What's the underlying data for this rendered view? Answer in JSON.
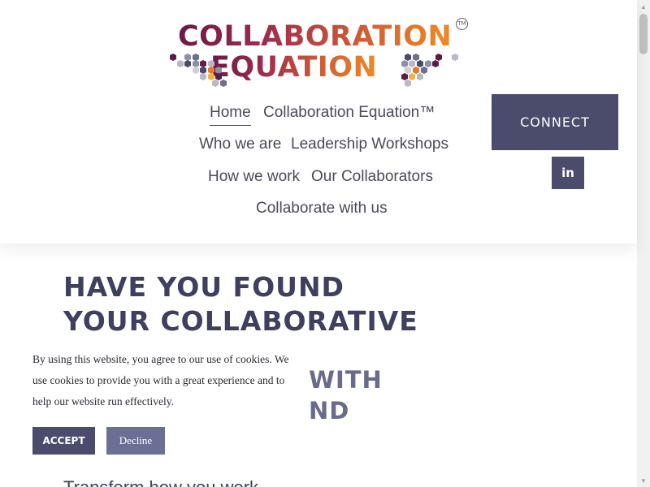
{
  "logo": {
    "line1": "COLLABORATION",
    "line2": "EQUATION",
    "tm": "TM",
    "colors": [
      "#6a1a44",
      "#9b2a4e",
      "#cf5a35",
      "#ee8a28"
    ]
  },
  "nav": {
    "items": [
      {
        "label": "Home",
        "active": true
      },
      {
        "label": "Collaboration Equation™"
      },
      {
        "label": "Who we are"
      },
      {
        "label": "Leadership Workshops"
      },
      {
        "label": "How we work"
      },
      {
        "label": "Our Collaborators"
      },
      {
        "label": "Collaborate with us"
      }
    ]
  },
  "header": {
    "connect_label": "CONNECT",
    "linkedin_label": "in",
    "linkedin_icon": "linkedin-icon"
  },
  "hero": {
    "title_line1": "HAVE YOU FOUND",
    "title_line2": "YOUR COLLABORATIVE",
    "title_line3": "WITH",
    "title_line4": "ND",
    "subtitle": "Transform how you work"
  },
  "cookie": {
    "text": "By using this website, you agree to our use of cookies. We use cookies to provide you with a great experience and to help our website run effectively.",
    "accept_label": "ACCEPT",
    "decline_label": "Decline"
  },
  "scrollbar": {
    "up_icon": "▲",
    "down_icon": "▼"
  },
  "colors": {
    "primary": "#4b4c6b",
    "secondary": "#6c6f94",
    "heading": "#3f4060"
  }
}
